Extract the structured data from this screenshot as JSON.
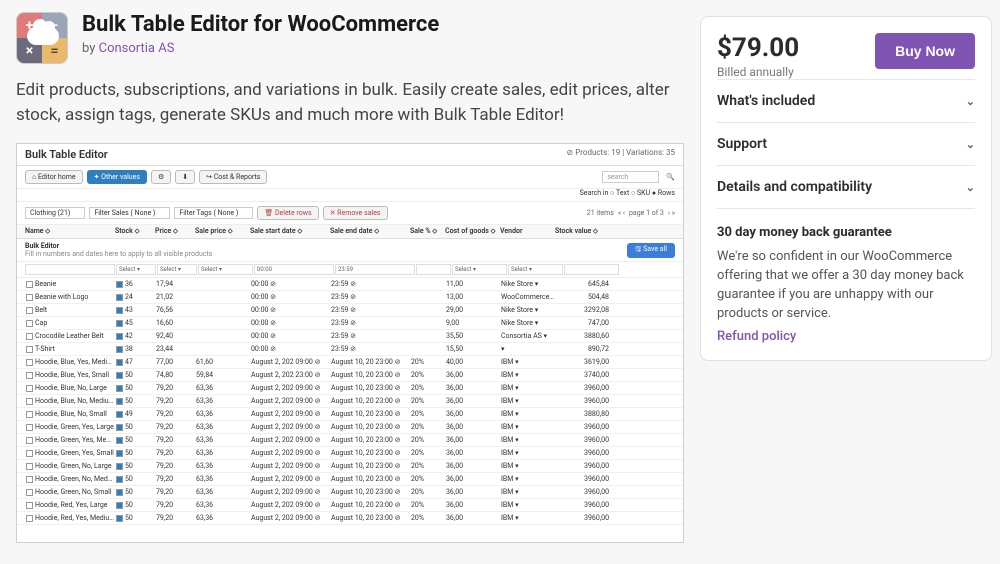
{
  "header": {
    "title": "Bulk Table Editor for WooCommerce",
    "by_prefix": "by ",
    "vendor": "Consortia AS"
  },
  "description": "Edit products, subscriptions, and variations in bulk. Easily create sales, edit prices, alter stock, assign tags, generate SKUs and much more with Bulk Table Editor!",
  "sidebar": {
    "price": "$79.00",
    "billing": "Billed annually",
    "buy": "Buy Now",
    "accordions": [
      "What's included",
      "Support",
      "Details and compatibility"
    ],
    "guarantee_title": "30 day money back guarantee",
    "guarantee_text": "We're so confident in our WooCommerce offering that we offer a 30 day money back guarantee if you are unhappy with our products or service.",
    "refund": "Refund policy"
  },
  "screenshot": {
    "title": "Bulk Table Editor",
    "meta": "⊘ Products: 19 | Variations: 35",
    "toolbar": {
      "home": "⌂ Editor home",
      "other": "✦ Other values",
      "gear": "⚙",
      "dl": "⬇",
      "cost": "↪ Cost & Reports",
      "search_ph": "search",
      "search_in": "Search in  ○ Text  ○ SKU  ● Rows"
    },
    "toolbar2": {
      "clothing": "Clothing  (21)",
      "filter_sales": "Filter Sales ( None )",
      "filter_tags": "Filter Tags ( None )",
      "delete": "🗑 Delete rows",
      "remove": "✕ Remove sales",
      "items": "21 items",
      "page": "page 1 of 3"
    },
    "columns": [
      "Name ⬦",
      "Stock ⬦",
      "Price ⬦",
      "Sale price ⬦",
      "Sale start date ⬦",
      "Sale end date ⬦",
      "Sale % ⬦",
      "Cost of goods ⬦",
      "Vendor",
      "Stock value ⬦"
    ],
    "bulk_editor_label": "Bulk Editor",
    "bulk_editor_hint": "Fill in numbers and dates here to apply to all visible products",
    "save": "🖫 Save all",
    "filter_cells": [
      "",
      "Select ▾",
      "Select ▾",
      "Select ▾",
      "00:00",
      "23:59",
      "",
      "Select ▾",
      "Select ▾",
      ""
    ],
    "rows": [
      {
        "n": "Beanie",
        "s": "36",
        "p": "17,94",
        "sp": "",
        "ss": "00:00",
        "se": "23:59",
        "pc": "",
        "cg": "11,00",
        "v": "Nike Store",
        "sv": "645,84"
      },
      {
        "n": "Beanie with Logo",
        "s": "24",
        "p": "21,02",
        "sp": "",
        "ss": "00:00",
        "se": "23:59",
        "pc": "",
        "cg": "13,00",
        "v": "WooCommerce",
        "sv": "504,48"
      },
      {
        "n": "Belt",
        "s": "43",
        "p": "76,56",
        "sp": "",
        "ss": "00:00",
        "se": "23:59",
        "pc": "",
        "cg": "29,00",
        "v": "Nike Store",
        "sv": "3292,08"
      },
      {
        "n": "Cap",
        "s": "45",
        "p": "16,60",
        "sp": "",
        "ss": "00:00",
        "se": "23:59",
        "pc": "",
        "cg": "9,00",
        "v": "Nike Store",
        "sv": "747,00"
      },
      {
        "n": "Crocodile Leather Belt",
        "s": "42",
        "p": "92,40",
        "sp": "",
        "ss": "00:00",
        "se": "23:59",
        "pc": "",
        "cg": "35,50",
        "v": "Consortia AS",
        "sv": "3880,60"
      },
      {
        "n": "T-Shirt",
        "s": "38",
        "p": "23,44",
        "sp": "",
        "ss": "00:00",
        "se": "23:59",
        "pc": "",
        "cg": "15,50",
        "v": "",
        "sv": "890,72"
      },
      {
        "n": "Hoodie, Blue, Yes, Medium",
        "s": "47",
        "p": "77,00",
        "sp": "61,60",
        "ss": "August 2, 202 09:00",
        "se": "August 10, 20 23:00",
        "pc": "20%",
        "cg": "40,00",
        "v": "IBM",
        "sv": "3619,00"
      },
      {
        "n": "Hoodie, Blue, Yes, Small",
        "s": "50",
        "p": "74,80",
        "sp": "59,84",
        "ss": "August 2, 202 23:00",
        "se": "August 10, 20 23:00",
        "pc": "20%",
        "cg": "36,00",
        "v": "IBM",
        "sv": "3740,00"
      },
      {
        "n": "Hoodie, Blue, No, Large",
        "s": "50",
        "p": "79,20",
        "sp": "63,36",
        "ss": "August 2, 202 09:00",
        "se": "August 10, 20 23:00",
        "pc": "20%",
        "cg": "36,00",
        "v": "IBM",
        "sv": "3960,00"
      },
      {
        "n": "Hoodie, Blue, No, Medium",
        "s": "50",
        "p": "79,20",
        "sp": "63,36",
        "ss": "August 2, 202 09:00",
        "se": "August 10, 20 23:00",
        "pc": "20%",
        "cg": "36,00",
        "v": "IBM",
        "sv": "3960,00"
      },
      {
        "n": "Hoodie, Blue, No, Small",
        "s": "49",
        "p": "79,20",
        "sp": "63,36",
        "ss": "August 2, 202 09:00",
        "se": "August 10, 20 23:00",
        "pc": "20%",
        "cg": "36,00",
        "v": "IBM",
        "sv": "3880,80"
      },
      {
        "n": "Hoodie, Green, Yes, Large",
        "s": "50",
        "p": "79,20",
        "sp": "63,36",
        "ss": "August 2, 202 09:00",
        "se": "August 10, 20 23:00",
        "pc": "20%",
        "cg": "36,00",
        "v": "IBM",
        "sv": "3960,00"
      },
      {
        "n": "Hoodie, Green, Yes, Medium",
        "s": "50",
        "p": "79,20",
        "sp": "63,36",
        "ss": "August 2, 202 09:00",
        "se": "August 10, 20 23:00",
        "pc": "20%",
        "cg": "36,00",
        "v": "IBM",
        "sv": "3960,00"
      },
      {
        "n": "Hoodie, Green, Yes, Small",
        "s": "50",
        "p": "79,20",
        "sp": "63,36",
        "ss": "August 2, 202 09:00",
        "se": "August 10, 20 23:00",
        "pc": "20%",
        "cg": "36,00",
        "v": "IBM",
        "sv": "3960,00"
      },
      {
        "n": "Hoodie, Green, No, Large",
        "s": "50",
        "p": "79,20",
        "sp": "63,36",
        "ss": "August 2, 202 09:00",
        "se": "August 10, 20 23:00",
        "pc": "20%",
        "cg": "36,00",
        "v": "IBM",
        "sv": "3960,00"
      },
      {
        "n": "Hoodie, Green, No, Medium",
        "s": "50",
        "p": "79,20",
        "sp": "63,36",
        "ss": "August 2, 202 09:00",
        "se": "August 10, 20 23:00",
        "pc": "20%",
        "cg": "36,00",
        "v": "IBM",
        "sv": "3960,00"
      },
      {
        "n": "Hoodie, Green, No, Small",
        "s": "50",
        "p": "79,20",
        "sp": "63,36",
        "ss": "August 2, 202 09:00",
        "se": "August 10, 20 23:00",
        "pc": "20%",
        "cg": "36,00",
        "v": "IBM",
        "sv": "3960,00"
      },
      {
        "n": "Hoodie, Red, Yes, Large",
        "s": "50",
        "p": "79,20",
        "sp": "63,36",
        "ss": "August 2, 202 09:00",
        "se": "August 10, 20 23:00",
        "pc": "20%",
        "cg": "36,00",
        "v": "IBM",
        "sv": "3960,00"
      },
      {
        "n": "Hoodie, Red, Yes, Medium",
        "s": "50",
        "p": "79,20",
        "sp": "63,36",
        "ss": "August 2, 202 09:00",
        "se": "August 10, 20 23:00",
        "pc": "20%",
        "cg": "36,00",
        "v": "IBM",
        "sv": "3960,00"
      }
    ]
  }
}
